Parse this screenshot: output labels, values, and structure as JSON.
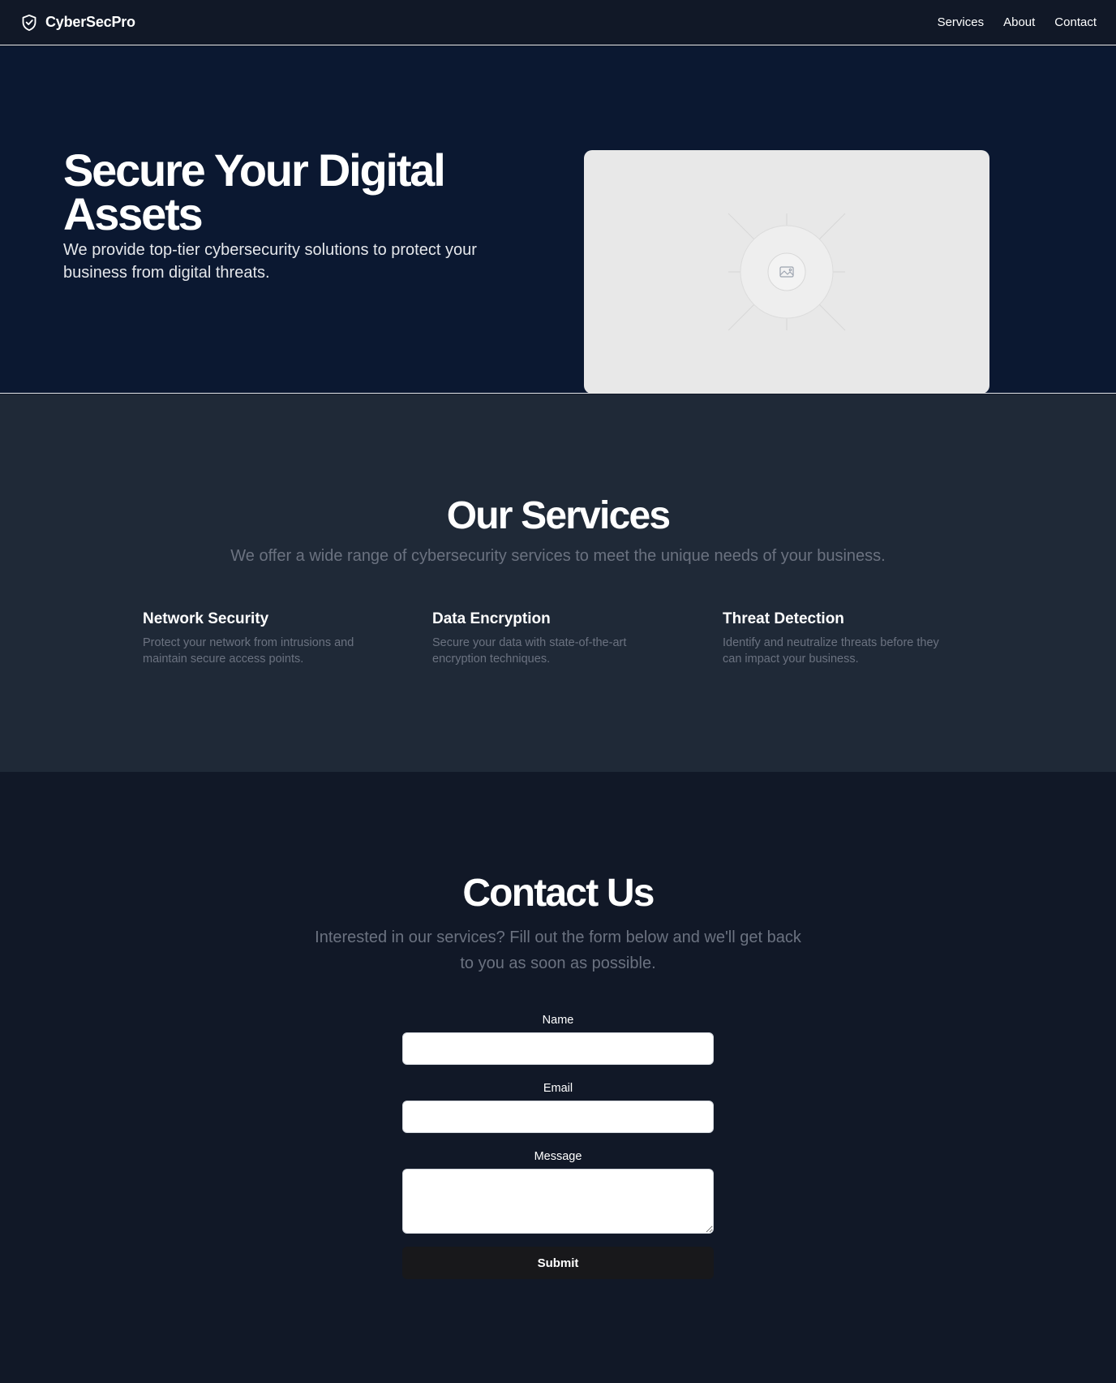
{
  "header": {
    "brand": "CyberSecPro",
    "brand_icon": "shield-check-icon",
    "nav": [
      "Services",
      "About",
      "Contact"
    ]
  },
  "hero": {
    "title": "Secure Your Digital Assets",
    "subtitle": "We provide top-tier cybersecurity solutions to protect your business from digital threats.",
    "image_icon": "image-placeholder-icon"
  },
  "services": {
    "title": "Our Services",
    "subtitle": "We offer a wide range of cybersecurity services to meet the unique needs of your business.",
    "items": [
      {
        "title": "Network Security",
        "description": "Protect your network from intrusions and maintain secure access points."
      },
      {
        "title": "Data Encryption",
        "description": "Secure your data with state-of-the-art encryption techniques."
      },
      {
        "title": "Threat Detection",
        "description": "Identify and neutralize threats before they can impact your business."
      }
    ]
  },
  "contact": {
    "title": "Contact Us",
    "subtitle": "Interested in our services? Fill out the form below and we'll get back to you as soon as possible.",
    "form": {
      "name_label": "Name",
      "name_value": "",
      "email_label": "Email",
      "email_value": "",
      "message_label": "Message",
      "message_value": "",
      "submit_label": "Submit"
    }
  },
  "colors": {
    "header_bg": "#111827",
    "hero_bg": "#0b1831",
    "services_bg": "#1f2937",
    "contact_bg": "#111827",
    "muted_text": "#6b7280",
    "button_bg": "#18181b",
    "placeholder_bg": "#e8e8e8"
  }
}
